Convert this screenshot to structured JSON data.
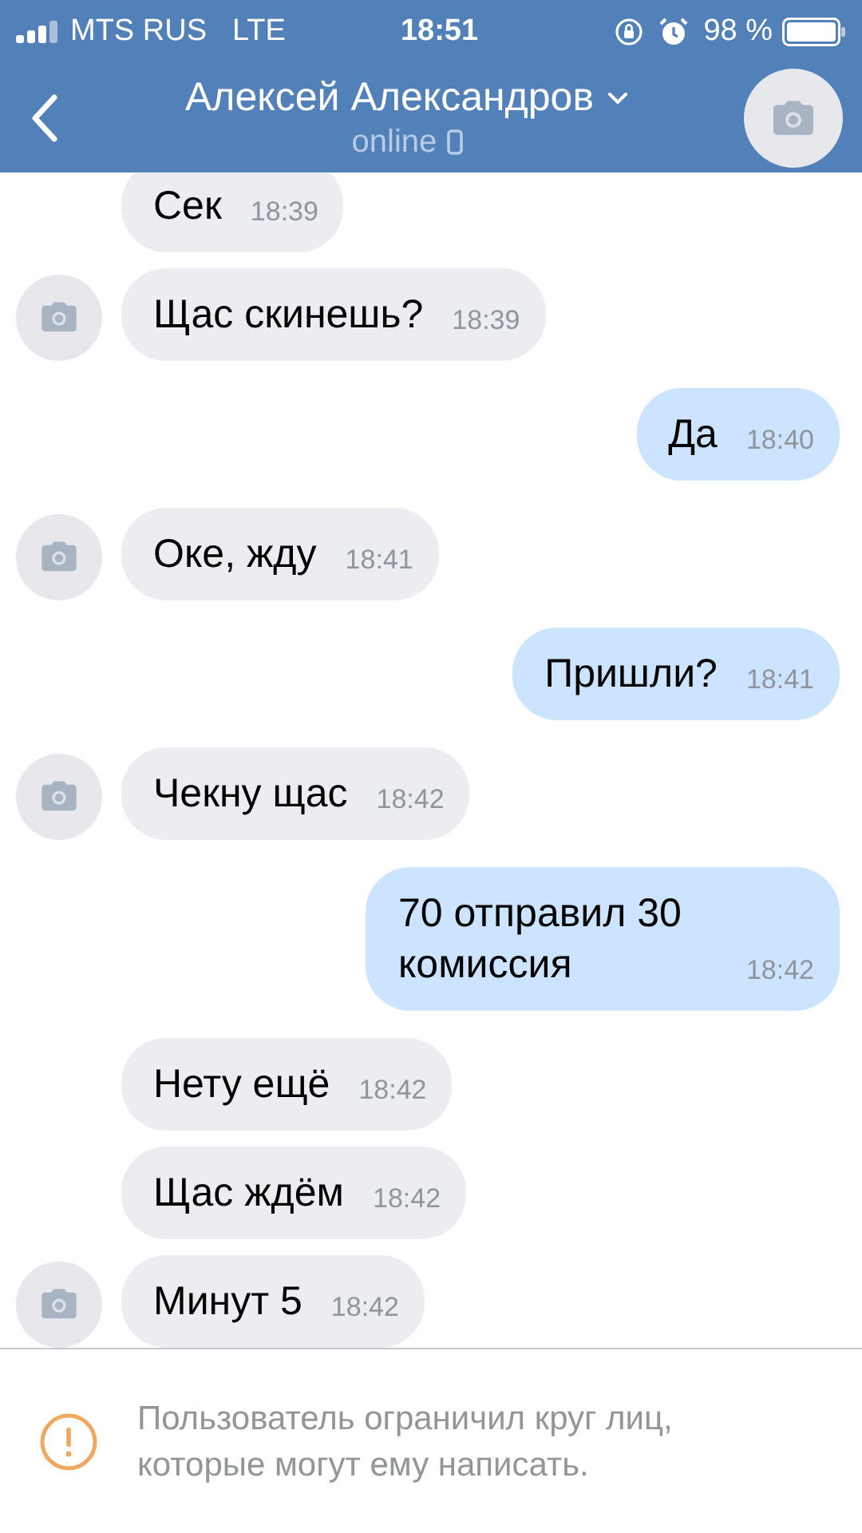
{
  "status_bar": {
    "carrier": "MTS RUS",
    "network": "LTE",
    "time": "18:51",
    "battery": "98 %"
  },
  "header": {
    "title": "Алексей Александров",
    "status": "online"
  },
  "messages": [
    {
      "kind": "incoming",
      "text": "Сек",
      "time": "18:39",
      "avatar": false
    },
    {
      "kind": "incoming",
      "text": "Щас скинешь?",
      "time": "18:39",
      "avatar": true
    },
    {
      "kind": "outgoing",
      "text": "Да",
      "time": "18:40"
    },
    {
      "kind": "incoming",
      "text": "Оке, жду",
      "time": "18:41",
      "avatar": true
    },
    {
      "kind": "outgoing",
      "text": "Пришли?",
      "time": "18:41"
    },
    {
      "kind": "incoming",
      "text": "Чекну щас",
      "time": "18:42",
      "avatar": true
    },
    {
      "kind": "outgoing",
      "text": "70 отправил 30 комиссия",
      "time": "18:42"
    },
    {
      "kind": "incoming",
      "text": "Нету ещё",
      "time": "18:42",
      "avatar": false
    },
    {
      "kind": "incoming",
      "text": "Щас ждём",
      "time": "18:42",
      "avatar": false
    },
    {
      "kind": "incoming",
      "text": "Минут 5",
      "time": "18:42",
      "avatar": true
    }
  ],
  "notice": {
    "text": "Пользователь ограничил круг лиц, которые могут ему написать."
  }
}
